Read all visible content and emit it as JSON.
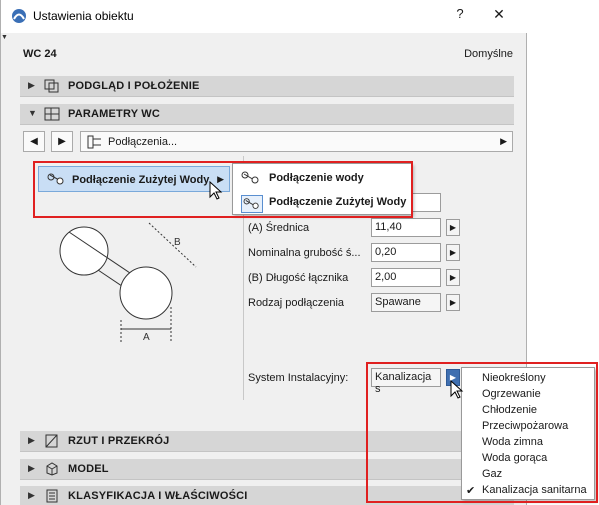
{
  "window": {
    "title": "Ustawienia obiektu",
    "help_label": "?",
    "close_label": "✕"
  },
  "header": {
    "object_name": "WC 24",
    "preset": "Domyślne"
  },
  "sections": {
    "preview": {
      "label": "PODGLĄD I POŁOŻENIE",
      "icon": "preview-icon"
    },
    "params": {
      "label": "PARAMETRY WC",
      "icon": "params-icon"
    },
    "plan": {
      "label": "RZUT I PRZEKRÓJ",
      "icon": "floorplan-icon"
    },
    "model": {
      "label": "MODEL",
      "icon": "cube-icon"
    },
    "classification": {
      "label": "KLASYFIKACJA I WŁAŚCIWOŚCI",
      "icon": "classification-icon"
    }
  },
  "nav": {
    "prev_label": "◀",
    "next_label": "▶",
    "page_label": "Podłączenia..."
  },
  "connection_button": {
    "label": "Podłączenie Zużytej Wody"
  },
  "connection_menu": [
    {
      "label": "Podłączenie wody",
      "active": false
    },
    {
      "label": "Podłączenie Zużytej Wody",
      "active": true
    }
  ],
  "drawing": {
    "label_a": "A",
    "label_b": "B"
  },
  "properties": [
    {
      "label": "(A) Średnica",
      "value": "11,40"
    },
    {
      "label": "Nominalna grubość ś...",
      "value": "0,20"
    },
    {
      "label": "(B) Długość łącznika",
      "value": "2,00"
    },
    {
      "label": "Rodzaj podłączenia",
      "value": "Spawane"
    }
  ],
  "system": {
    "label": "System Instalacyjny:",
    "value": "Kanalizacja s"
  },
  "system_menu": [
    {
      "label": "Nieokreślony",
      "checked": false
    },
    {
      "label": "Ogrzewanie",
      "checked": false
    },
    {
      "label": "Chłodzenie",
      "checked": false
    },
    {
      "label": "Przeciwpożarowa",
      "checked": false
    },
    {
      "label": "Woda zimna",
      "checked": false
    },
    {
      "label": "Woda gorąca",
      "checked": false
    },
    {
      "label": "Gaz",
      "checked": false
    },
    {
      "label": "Kanalizacja sanitarna",
      "checked": true
    }
  ],
  "colors": {
    "highlight": "#e02020",
    "selected_bg": "#c9def5",
    "section_bg": "#d6d6d6"
  }
}
